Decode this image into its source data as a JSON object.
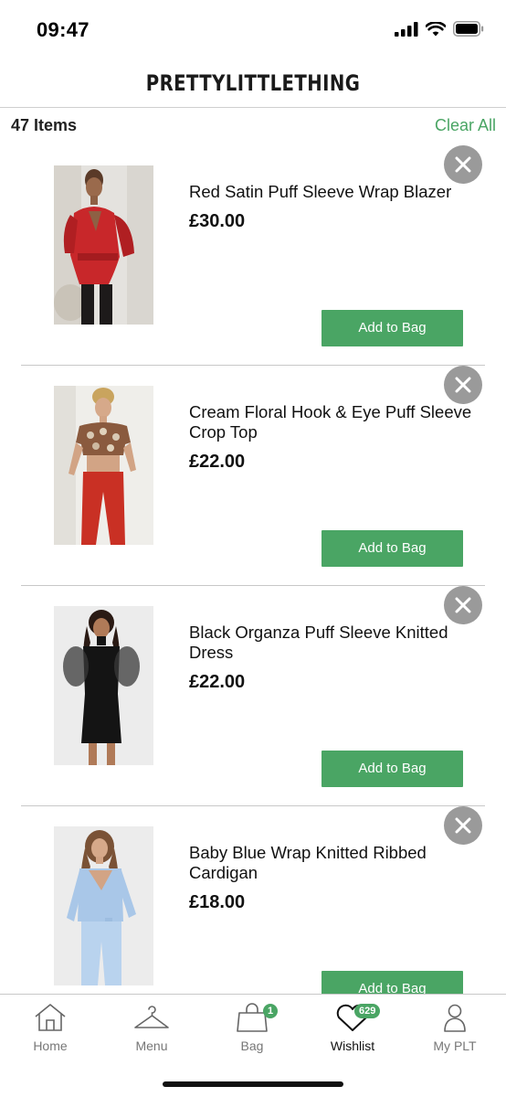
{
  "status_bar": {
    "time": "09:47",
    "icons": [
      "signal-icon",
      "wifi-icon",
      "battery-icon"
    ]
  },
  "header": {
    "brand": "PRETTYLITTLETHING"
  },
  "list": {
    "count_label": "47 Items",
    "clear_all_label": "Clear All"
  },
  "products": [
    {
      "name": "Red Satin Puff Sleeve Wrap Blazer",
      "price": "£30.00",
      "add_label": "Add to Bag",
      "image": "red-satin-blazer"
    },
    {
      "name": "Cream Floral Hook & Eye Puff Sleeve Crop Top",
      "price": "£22.00",
      "add_label": "Add to Bag",
      "image": "floral-crop-top"
    },
    {
      "name": "Black Organza Puff Sleeve Knitted Dress",
      "price": "£22.00",
      "add_label": "Add to Bag",
      "image": "black-knitted-dress"
    },
    {
      "name": "Baby Blue Wrap Knitted Ribbed Cardigan",
      "price": "£18.00",
      "add_label": "Add to Bag",
      "image": "baby-blue-cardigan"
    }
  ],
  "tab_bar": {
    "tabs": [
      {
        "label": "Home",
        "icon": "home-icon"
      },
      {
        "label": "Menu",
        "icon": "hanger-icon"
      },
      {
        "label": "Bag",
        "icon": "bag-icon",
        "badge": "1"
      },
      {
        "label": "Wishlist",
        "icon": "heart-icon",
        "badge": "629",
        "active": true
      },
      {
        "label": "My PLT",
        "icon": "user-icon"
      }
    ]
  },
  "colors": {
    "accent": "#4aa564",
    "remove_button": "#9a9a9a",
    "divider": "#c8c8c8"
  }
}
